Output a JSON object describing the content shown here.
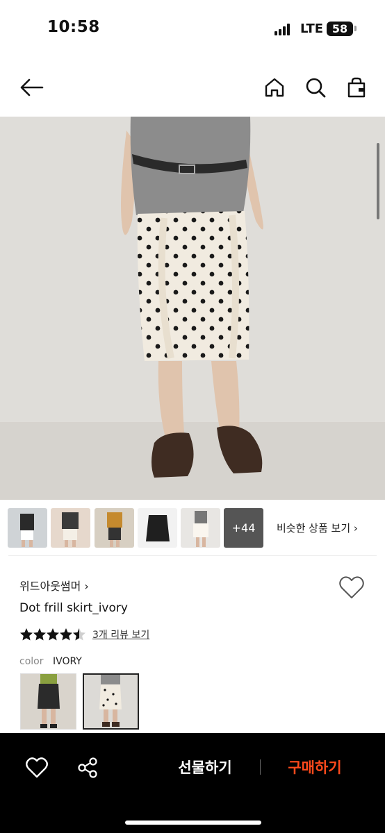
{
  "status": {
    "time": "10:58",
    "network": "LTE",
    "battery": "58"
  },
  "nav": {
    "back_icon": "arrow-left-icon",
    "home_icon": "home-icon",
    "search_icon": "search-icon",
    "bag_icon": "shopping-bag-icon"
  },
  "thumbnails": {
    "more_count": "+44",
    "similar_label": "비슷한 상품 보기 ›"
  },
  "product": {
    "brand": "위드아웃썸머 ›",
    "title": "Dot frill skirt_ivory",
    "rating": 4.5,
    "review_link": "3개 리뷰 보기",
    "color_label": "color",
    "color_value": "IVORY"
  },
  "bottom_bar": {
    "gift_label": "선물하기",
    "buy_label": "구매하기"
  },
  "colors": {
    "accent": "#ff4a1c",
    "bar_bg": "#000000"
  }
}
